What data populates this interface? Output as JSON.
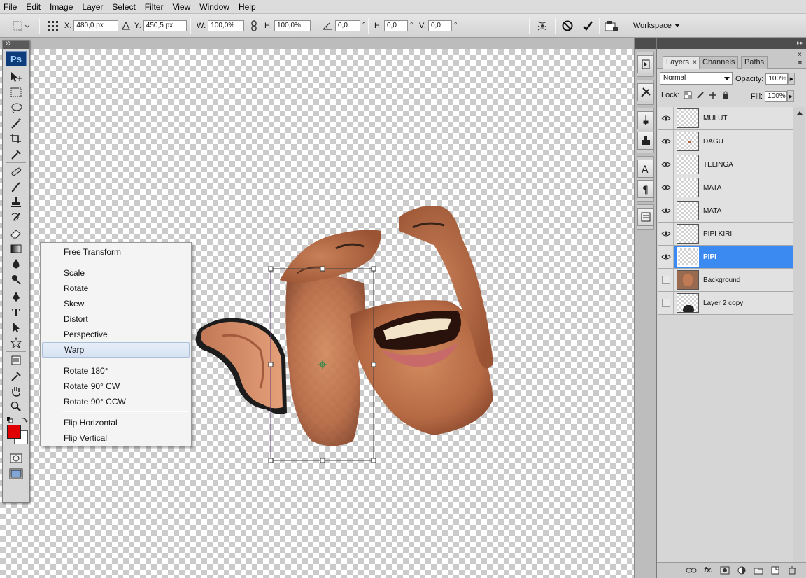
{
  "menubar": [
    "File",
    "Edit",
    "Image",
    "Layer",
    "Select",
    "Filter",
    "View",
    "Window",
    "Help"
  ],
  "options": {
    "x_label": "X:",
    "x_value": "480,0 px",
    "y_label": "Y:",
    "y_value": "450,5 px",
    "w_label": "W:",
    "w_value": "100,0%",
    "h_label": "H:",
    "h_value": "100,0%",
    "angle_value": "0,0",
    "hskew_label": "H:",
    "hskew_value": "0,0",
    "vskew_label": "V:",
    "vskew_value": "0,0",
    "degree": "°",
    "workspace_label": "Workspace"
  },
  "tools": {
    "ps_logo": "Ps"
  },
  "context_menu": {
    "groups": [
      [
        "Free Transform"
      ],
      [
        "Scale",
        "Rotate",
        "Skew",
        "Distort",
        "Perspective",
        "Warp"
      ],
      [
        "Rotate 180°",
        "Rotate 90° CW",
        "Rotate 90° CCW"
      ],
      [
        "Flip Horizontal",
        "Flip Vertical"
      ]
    ],
    "active": "Warp"
  },
  "layers_panel": {
    "tabs": [
      "Layers",
      "Channels",
      "Paths"
    ],
    "active_tab": "Layers",
    "blend_mode": "Normal",
    "opacity_label": "Opacity:",
    "opacity_value": "100%",
    "lock_label": "Lock:",
    "fill_label": "Fill:",
    "fill_value": "100%",
    "layers": [
      {
        "name": "MULUT",
        "visible": true,
        "selected": false
      },
      {
        "name": "DAGU",
        "visible": true,
        "selected": false
      },
      {
        "name": "TELINGA",
        "visible": true,
        "selected": false
      },
      {
        "name": "MATA",
        "visible": true,
        "selected": false
      },
      {
        "name": "MATA",
        "visible": true,
        "selected": false
      },
      {
        "name": "PIPI KIRI",
        "visible": true,
        "selected": false
      },
      {
        "name": "PIPI",
        "visible": true,
        "selected": true
      },
      {
        "name": "Background",
        "visible": false,
        "selected": false
      },
      {
        "name": "Layer 2 copy",
        "visible": false,
        "selected": false
      }
    ],
    "fx_label": "fx."
  },
  "colors": {
    "selection": "#3b8af2",
    "foreground_swatch": "#e00000",
    "background_swatch": "#ffffff",
    "app_chrome": "#d6d6d6"
  }
}
